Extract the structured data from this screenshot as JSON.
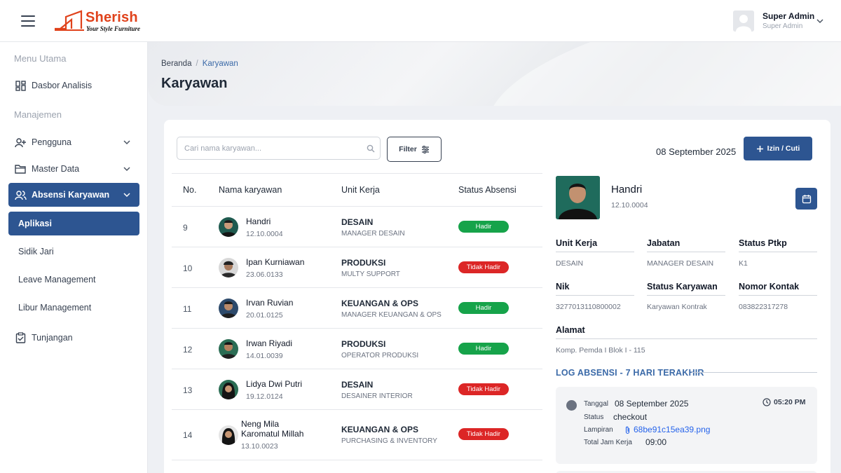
{
  "header": {
    "brand_name": "Sherish",
    "brand_tagline": "Your Style Furniture",
    "user_name": "Super Admin",
    "user_role": "Super Admin"
  },
  "sidebar": {
    "section_main": "Menu Utama",
    "dashboard": "Dasbor Analisis",
    "section_manage": "Manajemen",
    "pengguna": "Pengguna",
    "master_data": "Master Data",
    "absensi": "Absensi Karyawan",
    "sub_items": [
      "Aplikasi",
      "Sidik Jari",
      "Leave Management",
      "Libur Management"
    ],
    "tunjangan": "Tunjangan"
  },
  "page": {
    "breadcrumb_home": "Beranda",
    "breadcrumb_sep": "/",
    "breadcrumb_current": "Karyawan",
    "title": "Karyawan"
  },
  "toolbar": {
    "search_placeholder": "Cari nama karyawan...",
    "filter_label": "Filter",
    "date": "08 September 2025",
    "izin_label": "Izin / Cuti"
  },
  "table": {
    "headers": [
      "No.",
      "Nama karyawan",
      "Unit Kerja",
      "Status Absensi"
    ],
    "rows": [
      {
        "no": "9",
        "name": "Handri",
        "nik": "12.10.0004",
        "unit": "DESAIN",
        "job": "MANAGER DESAIN",
        "status": "Hadir"
      },
      {
        "no": "10",
        "name": "Ipan Kurniawan",
        "nik": "23.06.0133",
        "unit": "PRODUKSI",
        "job": "MULTY SUPPORT",
        "status": "Tidak Hadir"
      },
      {
        "no": "11",
        "name": "Irvan Ruvian",
        "nik": "20.01.0125",
        "unit": "KEUANGAN & OPS",
        "job": "MANAGER KEUANGAN & OPS",
        "status": "Hadir"
      },
      {
        "no": "12",
        "name": "Irwan Riyadi",
        "nik": "14.01.0039",
        "unit": "PRODUKSI",
        "job": "OPERATOR PRODUKSI",
        "status": "Hadir"
      },
      {
        "no": "13",
        "name": "Lidya Dwi Putri",
        "nik": "19.12.0124",
        "unit": "DESAIN",
        "job": "DESAINER INTERIOR",
        "status": "Tidak Hadir"
      },
      {
        "no": "14",
        "name_line1": "Neng Mila",
        "name_line2": "Karomatul Millah",
        "nik": "13.10.0023",
        "unit": "KEUANGAN & OPS",
        "job": "PURCHASING & INVENTORY",
        "status": "Tidak Hadir"
      }
    ]
  },
  "detail": {
    "name": "Handri",
    "nik_code": "12.10.0004",
    "labels": {
      "unit": "Unit Kerja",
      "jabatan": "Jabatan",
      "ptkp": "Status Ptkp",
      "nik": "Nik",
      "status_karyawan": "Status Karyawan",
      "kontak": "Nomor Kontak",
      "alamat": "Alamat"
    },
    "values": {
      "unit": "DESAIN",
      "jabatan": "MANAGER DESAIN",
      "ptkp": "K1",
      "nik": "3277013110800002",
      "status_karyawan": "Karyawan Kontrak",
      "kontak": "083822317278",
      "alamat": "Komp. Pemda I Blok I - 115"
    },
    "log_title": "LOG ABSENSI - 7 HARI TERAKHIR",
    "log": {
      "tanggal_label": "Tanggal",
      "tanggal": "08 September 2025",
      "time": "05:20 PM",
      "status_label": "Status",
      "status": "checkout",
      "lampiran_label": "Lampiran",
      "lampiran": "68be91c15ea39.png",
      "total_label": "Total Jam Kerja",
      "total": "09:00"
    }
  },
  "colors": {
    "primary": "#2d5591",
    "brand": "#e0421b",
    "hadir": "#16a34a",
    "tidak_hadir": "#dc2626"
  }
}
